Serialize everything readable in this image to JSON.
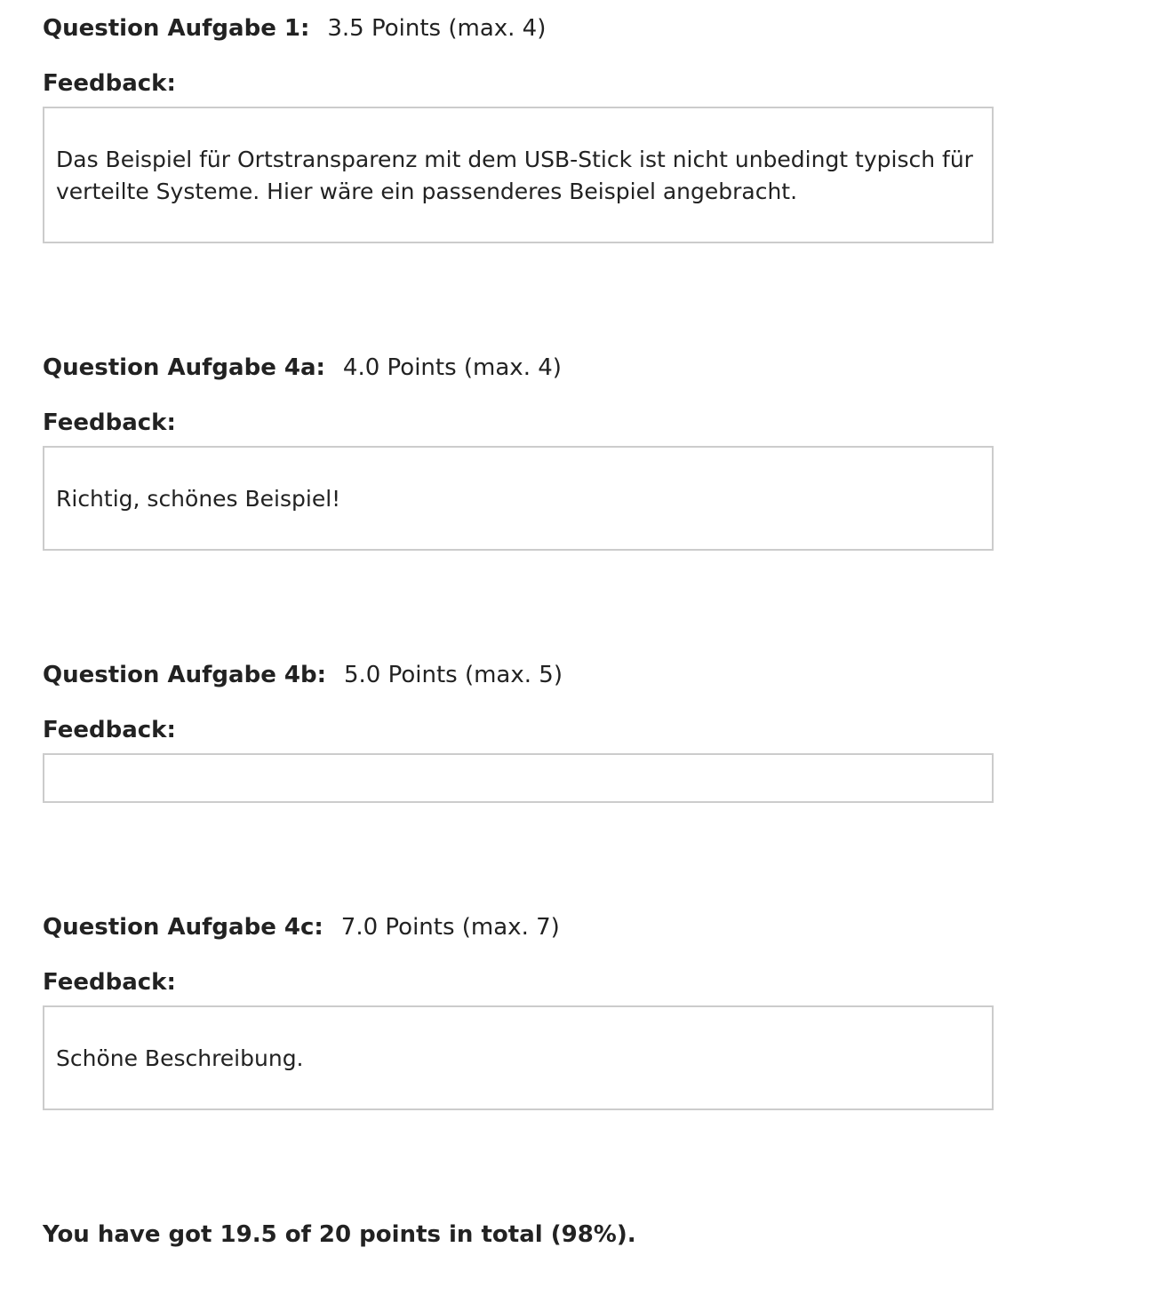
{
  "questions": [
    {
      "title": "Question Aufgabe 1:",
      "points": "3.5 Points (max. 4)",
      "feedback_label": "Feedback:",
      "feedback_text": "Das Beispiel für Ortstransparenz mit dem USB-Stick ist nicht unbedingt typisch für verteilte Systeme. Hier wäre ein passenderes Beispiel angebracht."
    },
    {
      "title": "Question Aufgabe 4a:",
      "points": "4.0 Points (max. 4)",
      "feedback_label": "Feedback:",
      "feedback_text": "Richtig, schönes Beispiel!"
    },
    {
      "title": "Question Aufgabe 4b:",
      "points": "5.0 Points (max. 5)",
      "feedback_label": "Feedback:",
      "feedback_text": ""
    },
    {
      "title": "Question Aufgabe 4c:",
      "points": "7.0 Points (max. 7)",
      "feedback_label": "Feedback:",
      "feedback_text": "Schöne Beschreibung."
    }
  ],
  "total": "You have got 19.5 of 20 points in total (98%)."
}
